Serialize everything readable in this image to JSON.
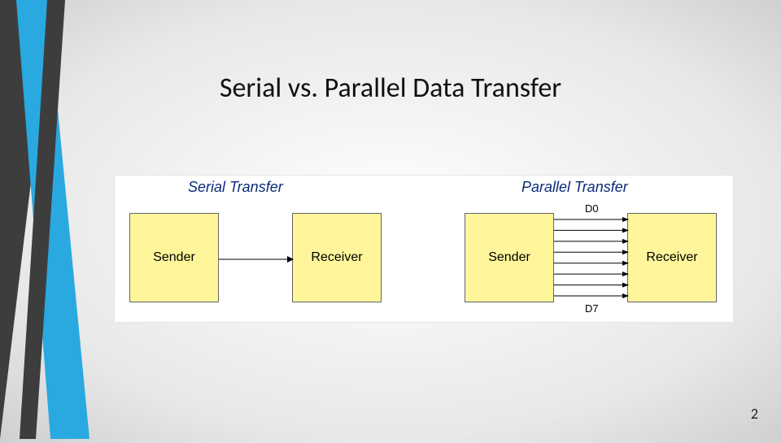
{
  "title": "Serial vs. Parallel Data Transfer",
  "page_number": "2",
  "serial": {
    "heading": "Serial Transfer",
    "sender_label": "Sender",
    "receiver_label": "Receiver"
  },
  "parallel": {
    "heading": "Parallel Transfer",
    "sender_label": "Sender",
    "receiver_label": "Receiver",
    "top_line_label": "D0",
    "bottom_line_label": "D7",
    "line_count": 8
  },
  "accent_colors": {
    "blue": "#2aa9e0",
    "dark": "#3d3d3d"
  }
}
